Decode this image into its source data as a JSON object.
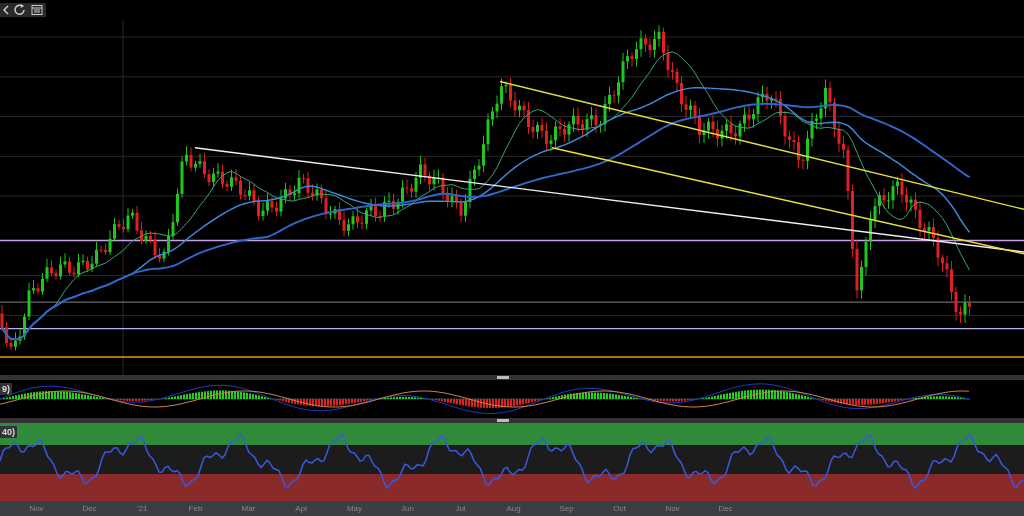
{
  "macd_pane": {
    "label": "9)"
  },
  "rsi_pane": {
    "label": "40)"
  },
  "x_axis": {
    "labels": [
      "Nov",
      "Dec",
      "'21",
      "Feb",
      "Mar",
      "Apr",
      "May",
      "Jun",
      "Jul",
      "Aug",
      "Sep",
      "Oct",
      "Nov",
      "Dec"
    ]
  }
}
